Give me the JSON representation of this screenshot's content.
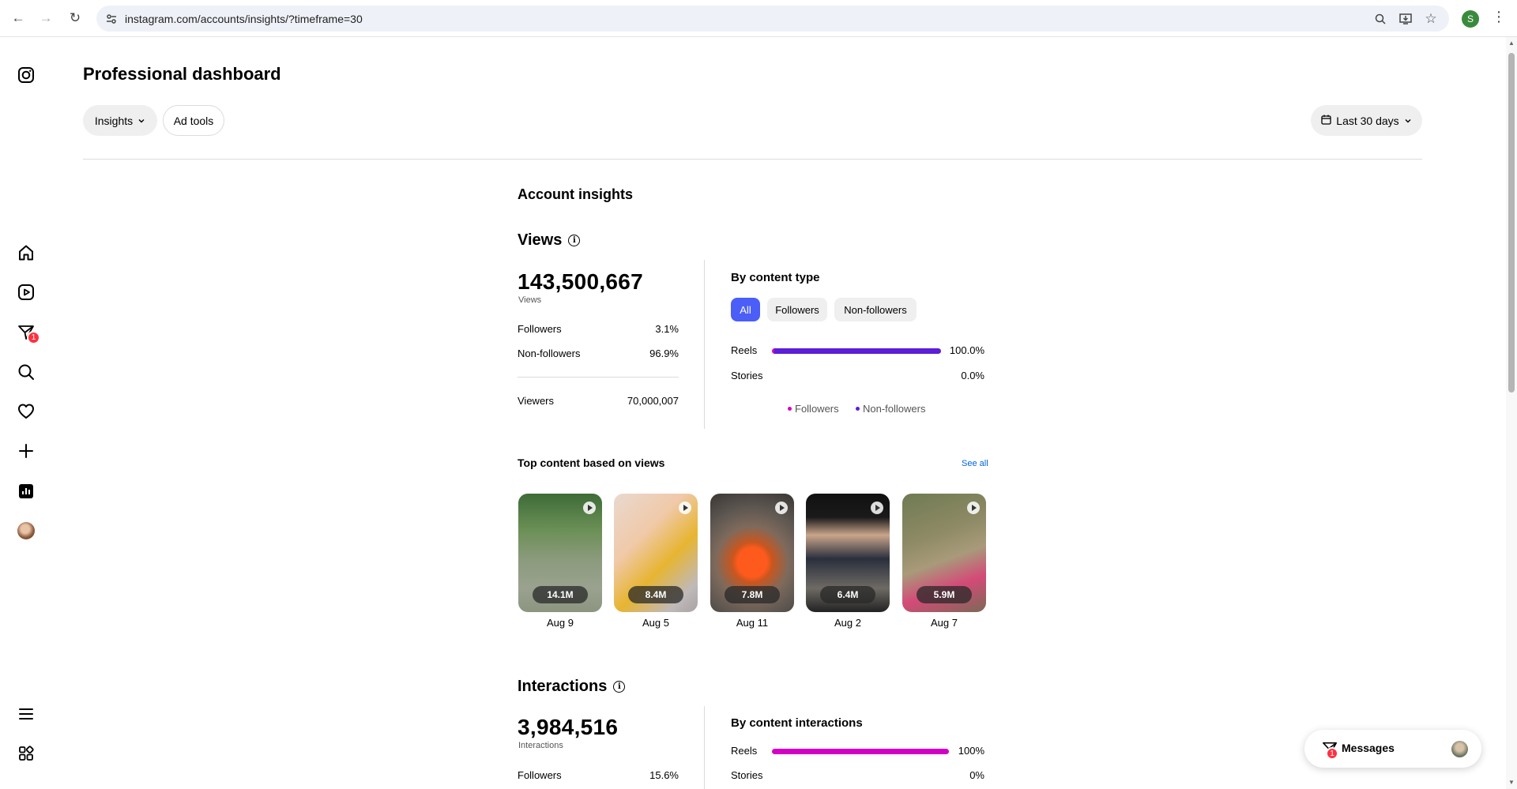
{
  "browser": {
    "url": "instagram.com/accounts/insights/?timeframe=30",
    "profile_initial": "S"
  },
  "sidebar": {
    "icons": [
      "instagram-icon",
      "home-icon",
      "reels-icon",
      "messenger-icon",
      "search-icon",
      "heart-icon",
      "plus-icon",
      "insights-icon",
      "avatar",
      "menu-icon",
      "apps-icon"
    ],
    "messenger_badge": "1"
  },
  "header": {
    "title": "Professional dashboard",
    "insights_label": "Insights",
    "ad_tools_label": "Ad tools",
    "date_range_label": "Last 30 days"
  },
  "account_insights": {
    "title": "Account insights",
    "views": {
      "title": "Views",
      "total": "143,500,667",
      "total_label": "Views",
      "followers_label": "Followers",
      "followers_value": "3.1%",
      "non_followers_label": "Non-followers",
      "non_followers_value": "96.9%",
      "viewers_label": "Viewers",
      "viewers_value": "70,000,007",
      "by_content_title": "By content type",
      "tabs": [
        "All",
        "Followers",
        "Non-followers"
      ],
      "rows": [
        {
          "label": "Reels",
          "value": "100.0%",
          "fraction": 1.0
        },
        {
          "label": "Stories",
          "value": "0.0%",
          "fraction": 0.0
        }
      ],
      "legend": [
        "Followers",
        "Non-followers"
      ]
    },
    "top_content": {
      "title": "Top content based on views",
      "see_all": "See all",
      "items": [
        {
          "count": "14.1M",
          "date": "Aug 9"
        },
        {
          "count": "8.4M",
          "date": "Aug 5"
        },
        {
          "count": "7.8M",
          "date": "Aug 11"
        },
        {
          "count": "6.4M",
          "date": "Aug 2"
        },
        {
          "count": "5.9M",
          "date": "Aug 7"
        }
      ]
    },
    "interactions": {
      "title": "Interactions",
      "total": "3,984,516",
      "total_label": "Interactions",
      "followers_label": "Followers",
      "followers_value": "15.6%",
      "by_content_title": "By content interactions",
      "rows": [
        {
          "label": "Reels",
          "value": "100%",
          "fraction": 1.0
        },
        {
          "label": "Stories",
          "value": "0%",
          "fraction": 0.0
        }
      ]
    }
  },
  "messages": {
    "label": "Messages",
    "badge": "1"
  },
  "colors": {
    "accent_blue": "#4b5ef7",
    "followers_color": "#d300c5",
    "non_followers_color": "#5c1ed6",
    "badge_red": "#ff3040",
    "link_blue": "#0064e0"
  }
}
